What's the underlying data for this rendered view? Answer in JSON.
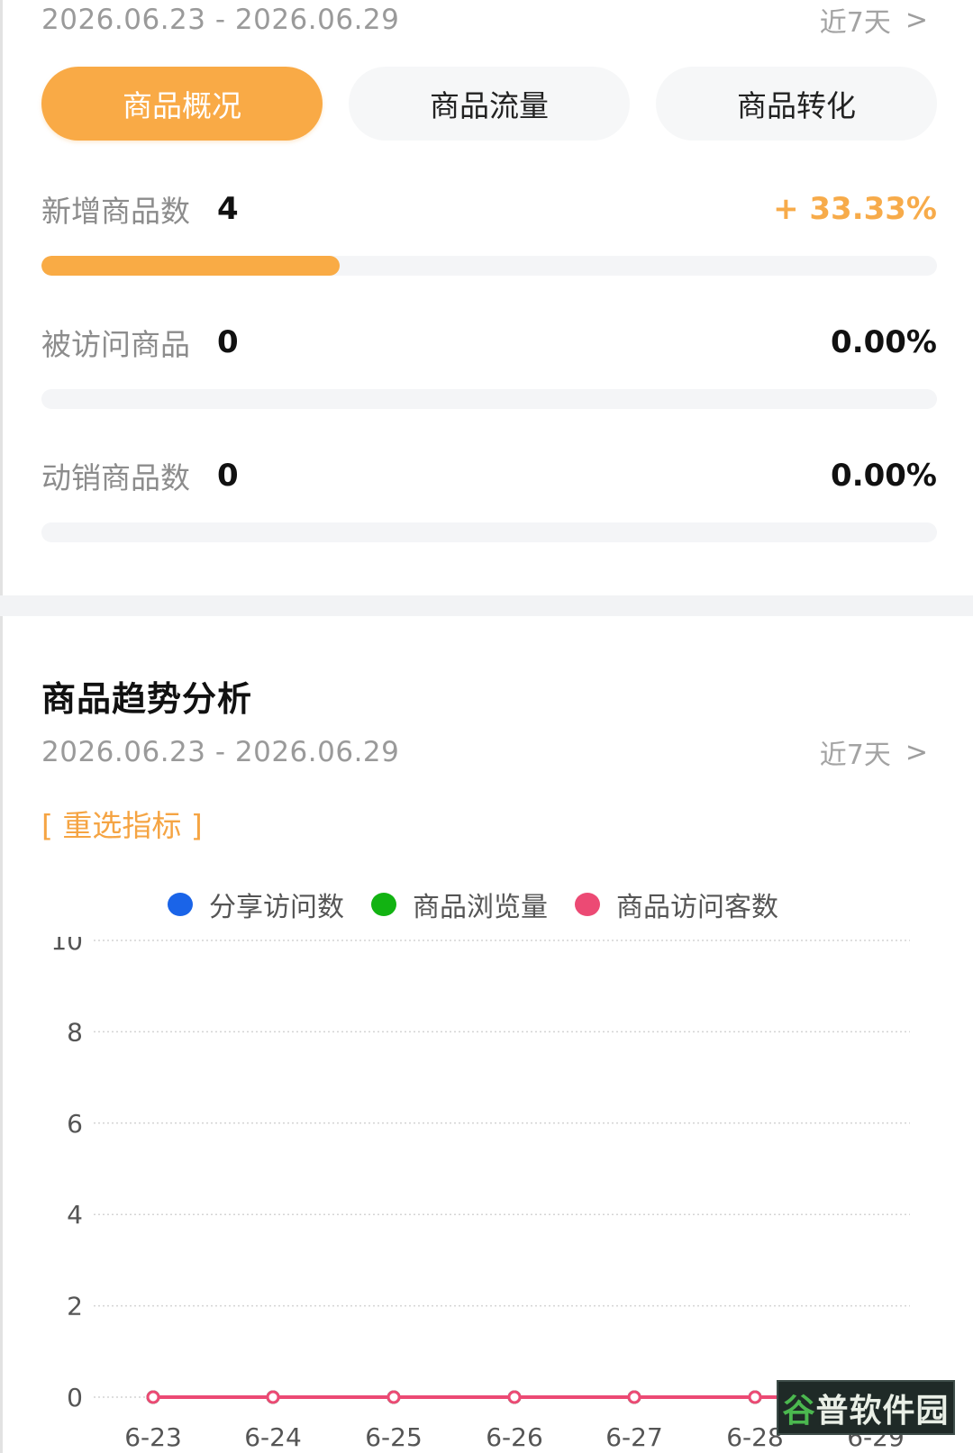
{
  "top": {
    "date_range": "2026.06.23 - 2026.06.29",
    "period_label": "近7天",
    "chevron": ">"
  },
  "tabs": [
    {
      "label": "商品概况",
      "active": true
    },
    {
      "label": "商品流量",
      "active": false
    },
    {
      "label": "商品转化",
      "active": false
    }
  ],
  "metrics": [
    {
      "label": "新增商品数",
      "value": "4",
      "change": "+ 33.33%",
      "progress": 0.3333
    },
    {
      "label": "被访问商品",
      "value": "0",
      "change": "0.00%",
      "progress": 0
    },
    {
      "label": "动销商品数",
      "value": "0",
      "change": "0.00%",
      "progress": 0
    }
  ],
  "trend": {
    "title": "商品趋势分析",
    "date_range": "2026.06.23 - 2026.06.29",
    "period_label": "近7天",
    "chevron": ">",
    "reselect_label": "[ 重选指标 ]"
  },
  "chart_data": {
    "type": "line",
    "x": [
      "6-23",
      "6-24",
      "6-25",
      "6-26",
      "6-27",
      "6-28",
      "6-29"
    ],
    "yticks": [
      0,
      2,
      4,
      6,
      8,
      10
    ],
    "ylim": [
      0,
      10
    ],
    "grid": true,
    "legend_position": "top-center",
    "series": [
      {
        "name": "分享访问数",
        "color": "#1a64e8",
        "values": [
          0,
          0,
          0,
          0,
          0,
          0,
          0
        ]
      },
      {
        "name": "商品浏览量",
        "color": "#12b312",
        "values": [
          0,
          0,
          0,
          0,
          0,
          0,
          0
        ]
      },
      {
        "name": "商品访问客数",
        "color": "#ec4a74",
        "values": [
          0,
          0,
          0,
          0,
          0,
          0,
          0
        ]
      }
    ]
  },
  "watermark": {
    "text_first": "谷",
    "text_rest": "普软件园"
  },
  "colors": {
    "accent": "#f9aa46",
    "track": "#f4f5f7"
  }
}
